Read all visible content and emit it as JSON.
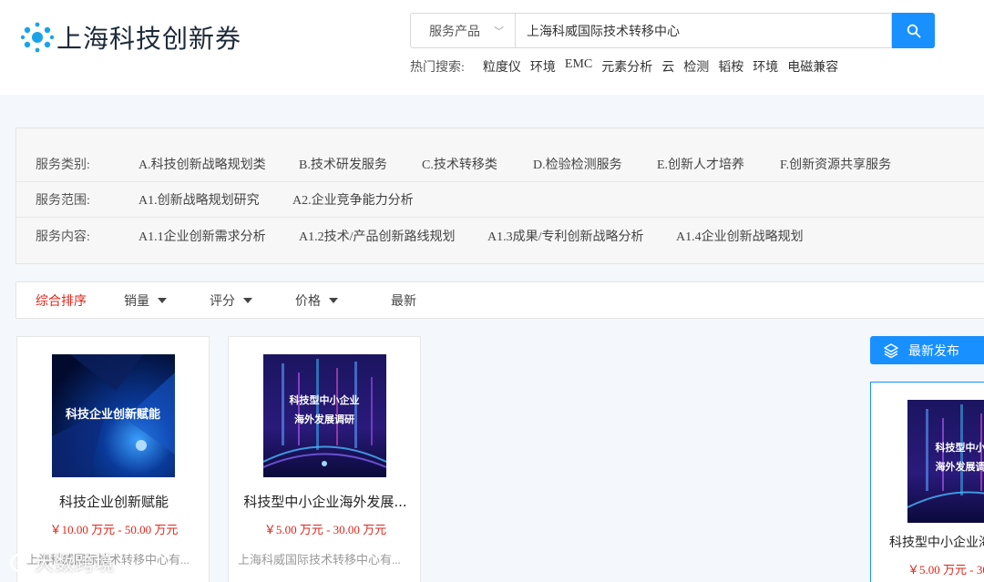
{
  "brand": {
    "name": "上海科技创新券"
  },
  "search": {
    "category": "服务产品",
    "value": "上海科威国际技术转移中心",
    "hot_label": "热门搜索:",
    "hot_items": [
      "粒度仪",
      "环境",
      "EMC",
      "元素分析",
      "云",
      "检测",
      "韬桉",
      "环境",
      "电磁兼容"
    ]
  },
  "filters": {
    "category": {
      "label": "服务类别:",
      "items": [
        "A.科技创新战略规划类",
        "B.技术研发服务",
        "C.技术转移类",
        "D.检验检测服务",
        "E.创新人才培养",
        "F.创新资源共享服务"
      ]
    },
    "scope": {
      "label": "服务范围:",
      "items": [
        "A1.创新战略规划研究",
        "A2.企业竞争能力分析"
      ]
    },
    "content": {
      "label": "服务内容:",
      "items": [
        "A1.1企业创新需求分析",
        "A1.2技术/产品创新路线规划",
        "A1.3成果/专利创新战略分析",
        "A1.4企业创新战略规划"
      ]
    }
  },
  "sort": {
    "comprehensive": "综合排序",
    "sales": "销量",
    "rating": "评分",
    "price": "价格",
    "newest": "最新"
  },
  "products": [
    {
      "title": "科技企业创新赋能",
      "image_text": "科技企业创新赋能",
      "price": "￥10.00 万元 - 50.00 万元",
      "shop": "上海科威国际技术转移中心有..."
    },
    {
      "title": "科技型中小企业海外发展...",
      "image_text_1": "科技型中小企业",
      "image_text_2": "海外发展调研",
      "price": "￥5.00 万元 - 30.00 万元",
      "shop": "上海科威国际技术转移中心有..."
    }
  ],
  "latest": {
    "heading": "最新发布",
    "title": "科技型中小企业海",
    "image_text_1": "科技型中小",
    "image_text_2": "海外发展调",
    "price": "￥5.00 万元 - 30"
  },
  "watermark": {
    "text": "大数跨境"
  },
  "colors": {
    "accent": "#1890ff",
    "price": "#e0261b",
    "active_sort": "#e0261b"
  }
}
